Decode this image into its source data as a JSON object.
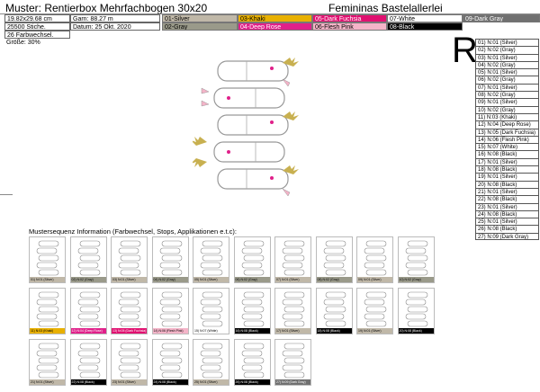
{
  "header": {
    "title": "Muster: Rentierbox Mehrfachbogen 30x20",
    "company": "Femininas Bastelallerlei"
  },
  "info": {
    "size": "19.82x29.68 cm",
    "yarn": "Garn: 88.27 m",
    "stitches": "25500 Stiche.",
    "date": "Datum: 25 Okt. 2020",
    "color_changes": "26 Farbwechsel.",
    "scale": "Größe: 30%"
  },
  "palette": [
    {
      "label": "01-Silver",
      "color": "#c0b8a8",
      "text": "#000"
    },
    {
      "label": "02-Gray",
      "color": "#9a9a8a",
      "text": "#000"
    },
    {
      "label": "03-Khaki",
      "color": "#e8b000",
      "text": "#000"
    },
    {
      "label": "04-Deep Rose",
      "color": "#e0208a",
      "text": "#fff"
    },
    {
      "label": "05-Dark Fuchsia",
      "color": "#e01070",
      "text": "#fff"
    },
    {
      "label": "06-Flesh Pink",
      "color": "#f4b4c8",
      "text": "#000"
    },
    {
      "label": "07-White",
      "color": "#ffffff",
      "text": "#000"
    },
    {
      "label": "08-Black",
      "color": "#000000",
      "text": "#fff"
    },
    {
      "label": "09-Dark Gray",
      "color": "#707070",
      "text": "#fff"
    }
  ],
  "big_letter": "R",
  "sequence": [
    "01) N:01 (Silver)",
    "02) N:02 (Gray)",
    "03) N:01 (Silver)",
    "04) N:02 (Gray)",
    "05) N:01 (Silver)",
    "06) N:02 (Gray)",
    "07) N:01 (Silver)",
    "08) N:02 (Gray)",
    "09) N:01 (Silver)",
    "10) N:02 (Gray)",
    "11) N:03 (Khaki)",
    "12) N:04 (Deep Rose)",
    "13) N:05 (Dark Fuchsia)",
    "14) N:06 (Flesh Pink)",
    "15) N:07 (White)",
    "16) N:08 (Black)",
    "17) N:01 (Silver)",
    "18) N:08 (Black)",
    "19) N:01 (Silver)",
    "20) N:08 (Black)",
    "21) N:01 (Silver)",
    "22) N:08 (Black)",
    "23) N:01 (Silver)",
    "24) N:08 (Black)",
    "25) N:01 (Silver)",
    "26) N:08 (Black)",
    "27) N:09 (Dark Gray)"
  ],
  "seq_title": "Mustersequenz Information (Farbwechsel, Stops, Applikationen e.t.c):",
  "thumbnails": [
    {
      "label": "01) N:01 (Silver)",
      "color": "#c0b8a8",
      "text": "#000"
    },
    {
      "label": "02) N:02 (Gray)",
      "color": "#9a9a8a",
      "text": "#000"
    },
    {
      "label": "03) N:01 (Silver)",
      "color": "#c0b8a8",
      "text": "#000"
    },
    {
      "label": "04) N:02 (Gray)",
      "color": "#9a9a8a",
      "text": "#000"
    },
    {
      "label": "05) N:01 (Silver)",
      "color": "#c0b8a8",
      "text": "#000"
    },
    {
      "label": "06) N:02 (Gray)",
      "color": "#9a9a8a",
      "text": "#000"
    },
    {
      "label": "07) N:01 (Silver)",
      "color": "#c0b8a8",
      "text": "#000"
    },
    {
      "label": "08) N:02 (Gray)",
      "color": "#9a9a8a",
      "text": "#000"
    },
    {
      "label": "09) N:01 (Silver)",
      "color": "#c0b8a8",
      "text": "#000"
    },
    {
      "label": "10) N:02 (Gray)",
      "color": "#9a9a8a",
      "text": "#000"
    },
    {
      "label": "11) N:03 (Khaki)",
      "color": "#e8b000",
      "text": "#000"
    },
    {
      "label": "12) N:04 (Deep Rose)",
      "color": "#e0208a",
      "text": "#fff"
    },
    {
      "label": "13) N:05 (Dark Fuchsia)",
      "color": "#e01070",
      "text": "#fff"
    },
    {
      "label": "14) N:06 (Flesh Pink)",
      "color": "#f4b4c8",
      "text": "#000"
    },
    {
      "label": "15) N:07 (White)",
      "color": "#ffffff",
      "text": "#000"
    },
    {
      "label": "16) N:08 (Black)",
      "color": "#000000",
      "text": "#fff"
    },
    {
      "label": "17) N:01 (Silver)",
      "color": "#c0b8a8",
      "text": "#000"
    },
    {
      "label": "18) N:08 (Black)",
      "color": "#000000",
      "text": "#fff"
    },
    {
      "label": "19) N:01 (Silver)",
      "color": "#c0b8a8",
      "text": "#000"
    },
    {
      "label": "20) N:08 (Black)",
      "color": "#000000",
      "text": "#fff"
    },
    {
      "label": "21) N:01 (Silver)",
      "color": "#c0b8a8",
      "text": "#000"
    },
    {
      "label": "22) N:08 (Black)",
      "color": "#000000",
      "text": "#fff"
    },
    {
      "label": "23) N:01 (Silver)",
      "color": "#c0b8a8",
      "text": "#000"
    },
    {
      "label": "24) N:08 (Black)",
      "color": "#000000",
      "text": "#fff"
    },
    {
      "label": "25) N:01 (Silver)",
      "color": "#c0b8a8",
      "text": "#000"
    },
    {
      "label": "26) N:08 (Black)",
      "color": "#000000",
      "text": "#fff"
    },
    {
      "label": "27) N:09 (Dark Gray)",
      "color": "#707070",
      "text": "#fff"
    }
  ]
}
